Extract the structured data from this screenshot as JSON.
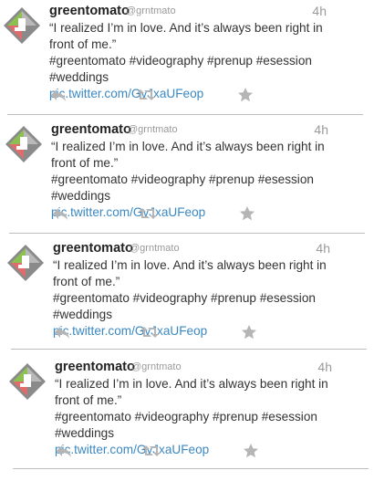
{
  "tweets": [
    {
      "name": "greentomato",
      "handle": "@grntmato",
      "time": "4h",
      "text_line1": "“I realized I’m in love. And it’s always been right in",
      "text_line2": "front of me.”",
      "hashtags": "#greentomato #videography #prenup #esession #weddings",
      "link": "pic.twitter.com/GvJxaUFeop"
    },
    {
      "name": "greentomato",
      "handle": "@grntmato",
      "time": "4h",
      "text_line1": "“I realized I’m in love. And it’s always been right in",
      "text_line2": "front of me.”",
      "hashtags": "#greentomato #videography #prenup #esession #weddings",
      "link": "pic.twitter.com/GvJxaUFeop"
    },
    {
      "name": "greentomato",
      "handle": "@grntmato",
      "time": "4h",
      "text_line1": "“I realized I’m in love. And it’s always been right in",
      "text_line2": "front of me.”",
      "hashtags": "#greentomato #videography #prenup #esession #weddings",
      "link": "pic.twitter.com/GvJxaUFeop"
    },
    {
      "name": "greentomato",
      "handle": "@grntmato",
      "time": "4h",
      "text_line1": "“I realized I’m in love. And it’s always been right in",
      "text_line2": "front of me.”",
      "hashtags": "#greentomato #videography #prenup #esession #weddings",
      "link": "pic.twitter.com/GvJxaUFeop"
    }
  ],
  "icons": {
    "avatar": "greentomato-logo",
    "reply": "reply-icon",
    "retweet": "retweet-icon",
    "favorite": "star-icon"
  },
  "colors": {
    "link": "#3b88c3",
    "icon": "#b5b5b5",
    "logo_green": "#8cc152",
    "logo_red": "#e06c6c",
    "logo_gray": "#8a8a8a"
  }
}
